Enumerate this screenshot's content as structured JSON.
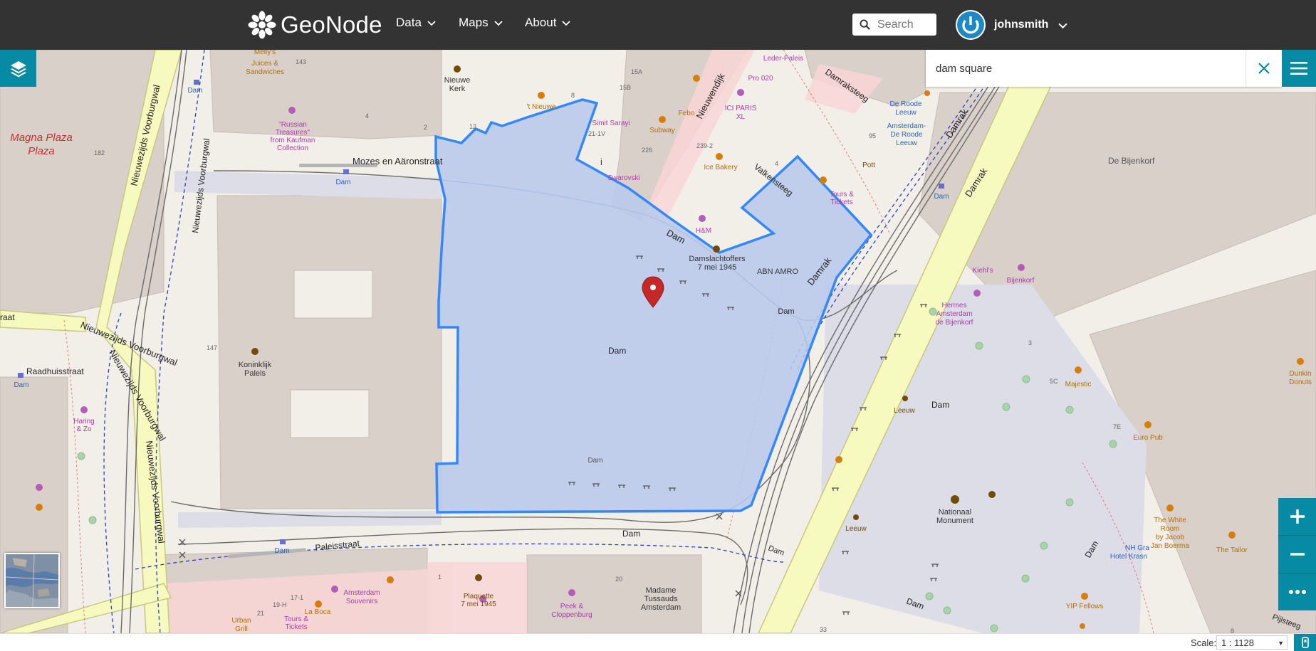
{
  "navbar": {
    "brand": "GeoNode",
    "menu": [
      {
        "label": "Data"
      },
      {
        "label": "Maps"
      },
      {
        "label": "About"
      }
    ],
    "search_placeholder": "Search",
    "username": "johnsmith"
  },
  "map_search": {
    "value": "dam square"
  },
  "footer": {
    "scale_label": "Scale:",
    "scale_value": "1 : 1128"
  },
  "colors": {
    "navbar": "#333333",
    "accent": "#078aa3",
    "highlight_fill": "#b8c9ec",
    "highlight_stroke": "#3388ff",
    "marker": "#c62828"
  },
  "icons": {
    "layers": "layers-icon",
    "close": "close-icon",
    "menu": "hamburger-icon",
    "zoom_in": "plus-icon",
    "zoom_out": "minus-icon",
    "more": "ellipsis-icon",
    "marker": "map-marker-icon",
    "search": "search-icon"
  },
  "map_labels": {
    "magna_plaza": "Magna Plaza",
    "mozes": "Mozes en Aäronstraat",
    "dam_square": "Dam",
    "dam_street": "Dam",
    "dam_east": "Dam",
    "damrak": "Damrak",
    "damrak2": "Damrak",
    "damrak3": "Damrak",
    "nieuwendijk": "Nieuwendijk",
    "valkensteeg": "Valkensteeg",
    "damraksteeg": "Damraksteeg",
    "paleisstraat": "Paleisstraat",
    "raadhuisstraat": "Raadhuisstraat",
    "nzv1": "Nieuwezijds Voorburgwal",
    "nzv2": "Nieuwezijds Voorburgwal",
    "nzv3": "Nieuwezijds Voorburgwal",
    "nzv4": "Nieuwezijds Voorburgwal",
    "de_bijenkorf": "De Bijenkorf",
    "koninklijk1": "Koninklijk",
    "koninklijk2": "Paleis",
    "nieuwe1": "Nieuwe",
    "nieuwe2": "Kerk",
    "nationaal1": "Nationaal",
    "nationaal2": "Monument",
    "madame1": "Madame",
    "madame2": "Tussauds",
    "madame3": "Amsterdam",
    "damslacht1": "Damslachtoffers",
    "damslacht2": "7 mei 1945",
    "abn": "ABN AMRO",
    "hm": "H&M",
    "swarovski": "Swarovski",
    "simit1": "Simit Sarayi",
    "subway": "Subway",
    "febo": "Febo",
    "ice_bakery": "Ice Bakery",
    "icci1": "ICI PARIS",
    "icci2": "XL",
    "pro020": "Pro 020",
    "leder": "Leder-Paleis",
    "roode1": "De Roode",
    "roode2": "Leeuw",
    "ams1": "Amsterdam-",
    "ams2": "De Roode",
    "ams3": "Leeuw",
    "potts": "Pott",
    "tours1": "Tours &",
    "tours2": "Tickets",
    "kiehls": "Kiehl's",
    "bijenkorf": "Bijenkorf",
    "hermes1": "Hermes",
    "hermes2": "Amsterdam",
    "hermes3": "de Bijenkorf",
    "majestic": "Majestic",
    "euro_pub": "Euro Pub",
    "dunkin1": "Dunkin",
    "dunkin2": "Donuts",
    "leeuw1": "Leeuw",
    "leeuw2": "Leeuw",
    "white1": "The White",
    "white2": "Room",
    "white3": "by Jacob",
    "white4": "Jan Boerma",
    "tailor": "The Tailor",
    "nh1": "NH Gra",
    "nh2": "Hotel Krasn",
    "yip": "YIP Fellows",
    "peek1": "Peek &",
    "peek2": "Cloppenburg",
    "plaquette1": "Plaquette",
    "plaquette2": "7 mei 1945",
    "souv1": "Amsterdam",
    "souv2": "Souvenirs",
    "laboca": "La Boca",
    "tours3": "Tours &",
    "tours4": "Tickets",
    "urban1": "Urban",
    "urban2": "Grill",
    "melly1": "Melly's",
    "melly2": "Juices &",
    "melly3": "Sandwiches",
    "russian1": "\"Russian",
    "russian2": "Treasures\"",
    "russian3": "from Kaufman",
    "russian4": "Collection",
    "nieuwe_cafe1": "'t Nieuwe",
    "haring1": "Haring",
    "haring2": "& Zo",
    "dam_stop1": "Dam",
    "dam_stop2": "Dam",
    "dam_stop3": "Dam",
    "dam_stop4": "Dam",
    "dam_stop5": "Dam",
    "dam_stop6": "Dam",
    "dam_street2": "Dam",
    "dam_mon": "Dam",
    "pijlsteeg": "Pijlsteeg",
    "n143": "143",
    "n182": "182",
    "n147": "147",
    "n15a": "15A",
    "n15b": "15B",
    "n2": "2",
    "n4": "4",
    "n4b": "4",
    "n12": "12",
    "n8": "8",
    "n21": "21-1V",
    "n226": "226",
    "n239": "239-2",
    "n95": "95",
    "n3": "3",
    "n5c": "5C",
    "n7e": "7E",
    "n1": "1",
    "n20": "20",
    "n171": "17-1",
    "n19h": "19-H",
    "n21b": "21",
    "n33": "33",
    "n8b": "8",
    "dam_lbl_dam2": "Dam"
  }
}
